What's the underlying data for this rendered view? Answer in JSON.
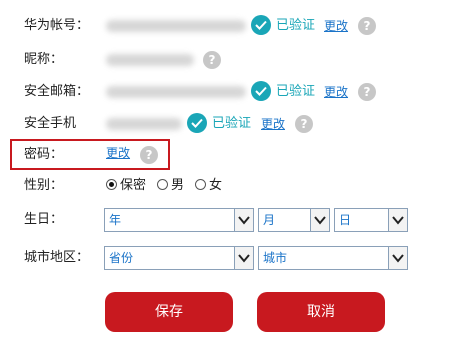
{
  "rows": {
    "account": {
      "label": "华为帐号：",
      "verified": "已验证",
      "change": "更改"
    },
    "nickname": {
      "label": "昵称："
    },
    "email": {
      "label": "安全邮箱：",
      "verified": "已验证",
      "change": "更改"
    },
    "phone": {
      "label": "安全手机",
      "verified": "已验证",
      "change": "更改"
    },
    "password": {
      "label": "密码：",
      "change": "更改"
    },
    "gender": {
      "label": "性别：",
      "options": [
        "保密",
        "男",
        "女"
      ],
      "selected": "保密"
    },
    "birthday": {
      "label": "生日：",
      "year": "年",
      "month": "月",
      "day": "日"
    },
    "region": {
      "label": "城市地区：",
      "province": "省份",
      "city": "城市"
    }
  },
  "buttons": {
    "save": "保存",
    "cancel": "取消"
  },
  "help_glyph": "?",
  "colors": {
    "accent": "#1aa6b7",
    "link": "#1a73c8",
    "primary_button": "#c8191f",
    "highlight_border": "#c8191f"
  }
}
